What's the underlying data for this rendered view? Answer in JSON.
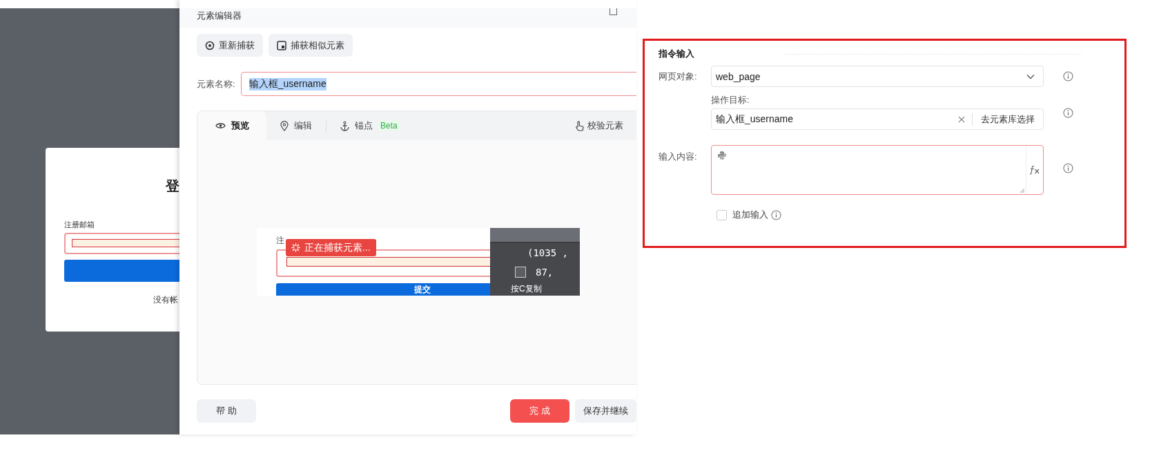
{
  "login_dialog": {
    "title": "登",
    "email_label": "注册邮箱",
    "signup_prompt": "没有帐"
  },
  "editor": {
    "title": "元素编辑器",
    "toolbar": [
      {
        "label": "重新捕获"
      },
      {
        "label": "捕获相似元素"
      }
    ],
    "name_label": "元素名称:",
    "name_value": "输入框_username",
    "name_text_selected": true,
    "tabs": [
      {
        "label": "预览",
        "selected": true
      },
      {
        "label": "编辑",
        "selected": false
      },
      {
        "label": "锚点",
        "badge": "Beta",
        "selected": false
      }
    ],
    "verify": "校验元素",
    "preview": {
      "field_label": "注",
      "toast": "正在捕获元素...",
      "coords": "(1035 ,",
      "size": "87,",
      "submit": "提交",
      "hint": "按C复制"
    },
    "footer": {
      "help": "帮 助",
      "done": "完 成",
      "save_continue": "保存并继续"
    }
  },
  "panel": {
    "section_title": "指令输入",
    "fields": [
      {
        "kind": "select",
        "label": "网页对象:",
        "value": "web_page"
      },
      {
        "kind": "target",
        "label": "操作目标:",
        "value": "输入框_username",
        "action": "去元素库选择"
      },
      {
        "kind": "textarea",
        "label": "输入内容:"
      }
    ],
    "append": {
      "label": "追加输入",
      "checked": false
    }
  }
}
